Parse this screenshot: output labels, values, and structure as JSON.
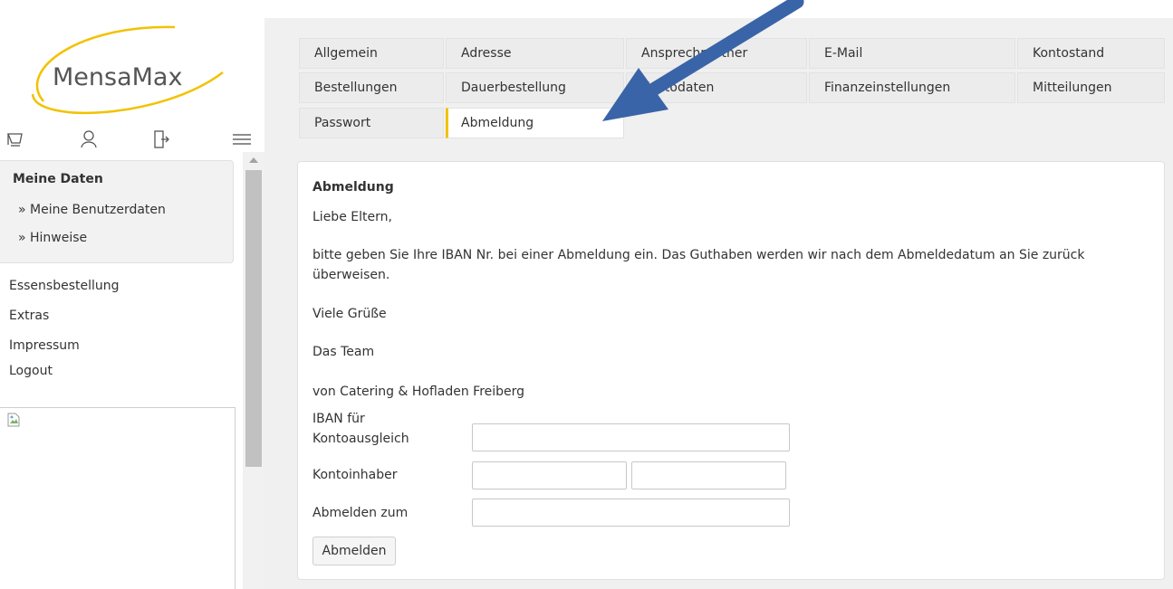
{
  "brand": {
    "logo_text": "MensaMax",
    "accent_color": "#f2c200",
    "arrow_color": "#3a64a8"
  },
  "toolbar_icons": [
    "cart-icon",
    "user-icon",
    "logout-icon",
    "menu-icon"
  ],
  "sidebar": {
    "section_title": "Meine Daten",
    "section_links": [
      "» Meine Benutzerdaten",
      "» Hinweise"
    ],
    "links": [
      "Essensbestellung",
      "Extras",
      "Impressum",
      "Logout"
    ]
  },
  "tabs": {
    "row1": [
      "Allgemein",
      "Adresse",
      "Ansprechpartner",
      "E-Mail",
      "Kontostand"
    ],
    "row2": [
      "Bestellungen",
      "Dauerbestellung",
      "Kontodaten",
      "Finanzeinstellungen",
      "Mitteilungen"
    ],
    "row3": [
      "Passwort",
      "Abmeldung"
    ],
    "active": "Abmeldung"
  },
  "content": {
    "title": "Abmeldung",
    "greeting": "Liebe Eltern,",
    "paragraph": "bitte geben Sie Ihre IBAN Nr. bei einer Abmeldung ein. Das Guthaben werden wir nach dem Abmeldedatum an Sie zurück überweisen.",
    "regards": "Viele Grüße",
    "team": "Das Team",
    "company": "von Catering & Hofladen Freiberg"
  },
  "form": {
    "iban_label": "IBAN für Kontoausgleich",
    "iban_value": "",
    "owner_label": "Kontoinhaber",
    "owner_first": "",
    "owner_last": "",
    "date_label": "Abmelden zum",
    "date_value": "",
    "submit_label": "Abmelden"
  }
}
